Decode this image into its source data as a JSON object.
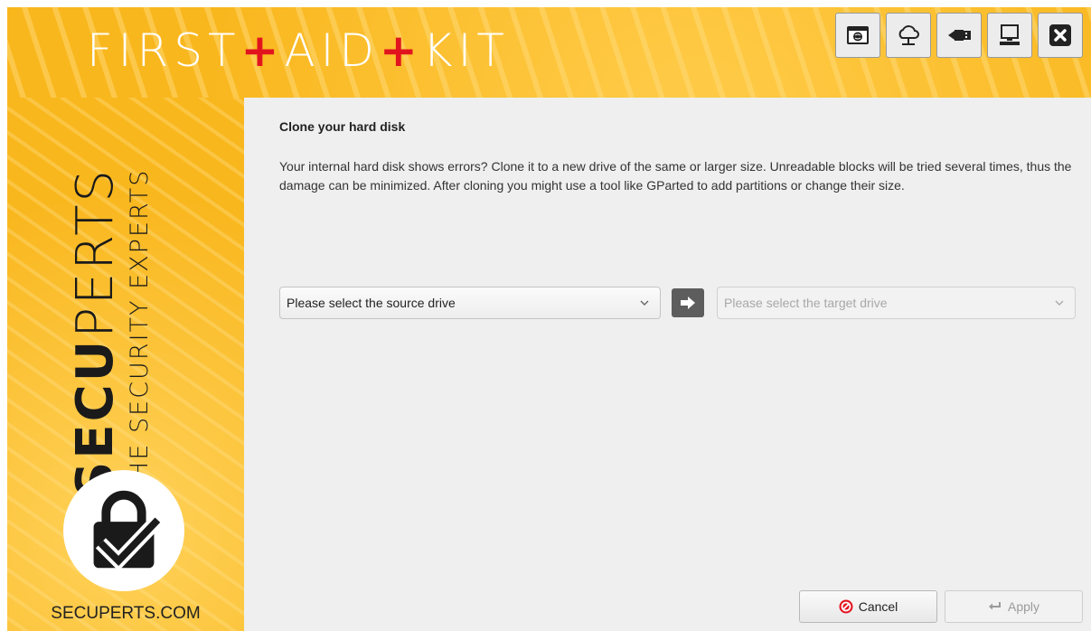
{
  "header": {
    "title_part1": "FIRST",
    "title_plus": "+",
    "title_part2": "AID",
    "title_part3": "KIT"
  },
  "toolbar": {
    "buttons": [
      {
        "icon": "browser-icon"
      },
      {
        "icon": "cloud-network-icon"
      },
      {
        "icon": "usb-icon"
      },
      {
        "icon": "computer-icon"
      },
      {
        "icon": "close-icon"
      }
    ]
  },
  "sidebar": {
    "brand_bold": "SECU",
    "brand_light": "PERTS",
    "tagline": "THE SECURITY EXPERTS",
    "website": "SECUPERTS.COM"
  },
  "main": {
    "title": "Clone your hard disk",
    "description": "Your internal hard disk shows errors? Clone it to a new drive of the same or larger size. Unreadable blocks will be tried several times, thus the damage can be minimized. After cloning you might use a tool like GParted to add partitions or change their size.",
    "source_select": {
      "value": "Please select the source drive"
    },
    "target_select": {
      "value": "Please select the target drive"
    }
  },
  "buttons": {
    "cancel": "Cancel",
    "apply": "Apply"
  },
  "colors": {
    "brand_yellow": "#f9b71e",
    "plus_red": "#e1141e",
    "content_bg": "#efefef"
  }
}
